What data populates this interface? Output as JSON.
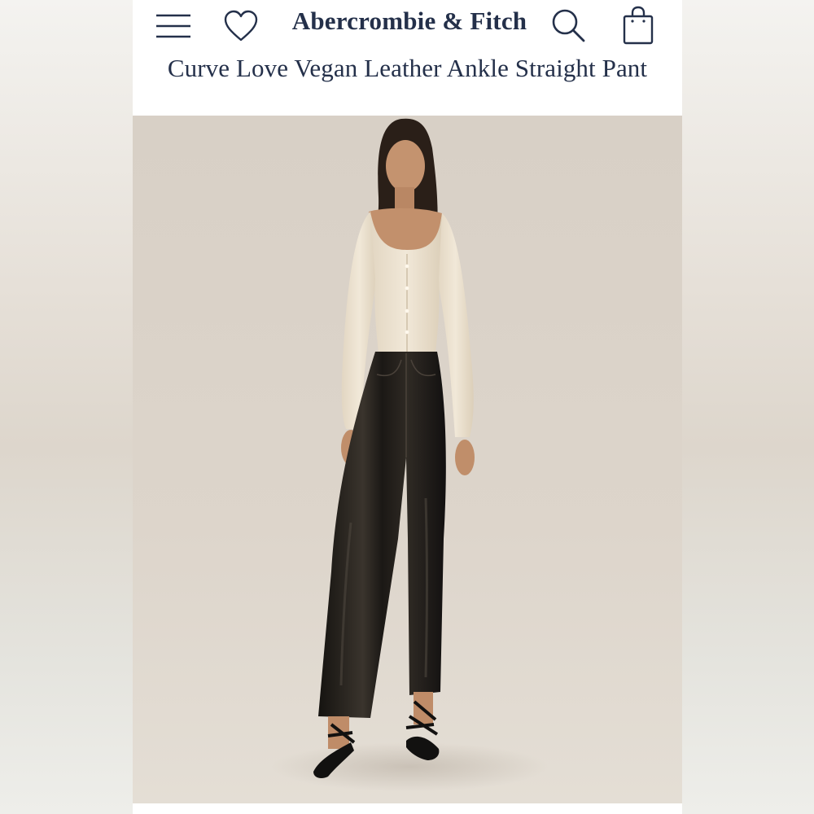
{
  "header": {
    "brand": "Abercrombie & Fitch",
    "icons": {
      "menu": "hamburger-menu-icon",
      "wishlist": "heart-icon",
      "search": "search-icon",
      "bag": "shopping-bag-icon"
    },
    "accent_color": "#24304a"
  },
  "product": {
    "title": "Curve Love Vegan Leather Ankle Straight Pant"
  }
}
